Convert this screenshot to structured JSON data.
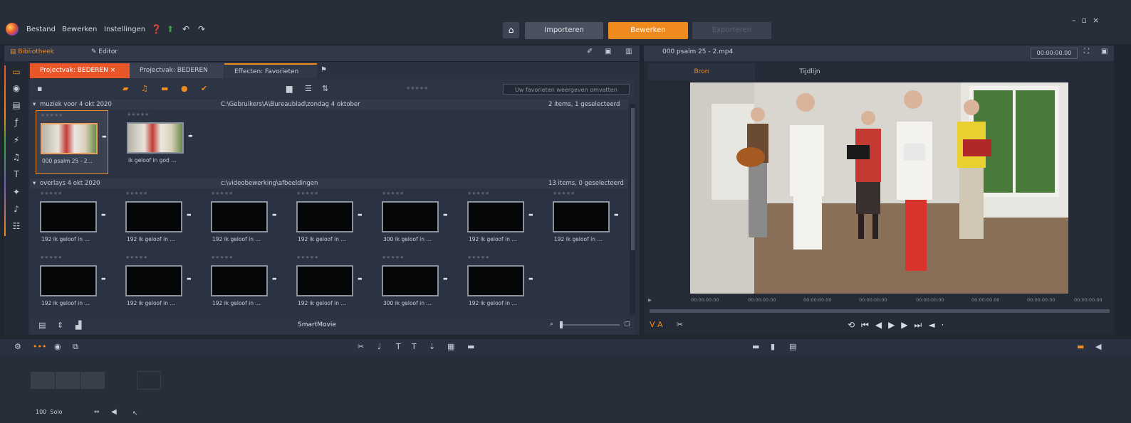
{
  "menu": {
    "file": "Bestand",
    "edit": "Bewerken",
    "settings": "Instellingen"
  },
  "modes": {
    "import": "Importeren",
    "edit": "Bewerken",
    "export": "Exporteren"
  },
  "panel_tabs": {
    "library": "Bibliotheek",
    "editor": "Editor"
  },
  "project_tabs": [
    "Projectvak: BEDEREN",
    "Projectvak: BEDEREN",
    "Effecten: Favorieten"
  ],
  "search_placeholder": "Uw favorieten weergeven omvatten",
  "groups": [
    {
      "title": "muziek voor 4 okt 2020",
      "path": "C:\\Gebruikers\\A\\Bureaublad\\zondag 4 oktober",
      "count": "2 items, 1 geselecteerd",
      "items": [
        {
          "caption": "000 psalm 25 - 2..."
        },
        {
          "caption": "ik geloof in god ..."
        }
      ]
    },
    {
      "title": "overlays 4 okt 2020",
      "path": "c:\\videobewerking\\afbeeldingen",
      "count": "13 items, 0 geselecteerd",
      "items": [
        {
          "caption": "192 ik geloof in ..."
        },
        {
          "caption": "192 ik geloof in ..."
        },
        {
          "caption": "192 ik geloof in ..."
        },
        {
          "caption": "192 ik geloof in ..."
        },
        {
          "caption": "300 ik geloof in ..."
        },
        {
          "caption": "192 ik geloof in ..."
        },
        {
          "caption": "192 ik geloof in ..."
        },
        {
          "caption": "192 ik geloof in ..."
        },
        {
          "caption": "192 ik geloof in ..."
        },
        {
          "caption": "192 ik geloof in ..."
        },
        {
          "caption": "192 ik geloof in ..."
        },
        {
          "caption": "300 ik geloof in ..."
        },
        {
          "caption": "192 ik geloof in ..."
        }
      ]
    }
  ],
  "stars": "★★★★★",
  "smartmovie": "SmartMovie",
  "preview": {
    "filename": "000 psalm 25 - 2.mp4",
    "timecode": "00:00:00.00",
    "tab_source": "Bron",
    "tab_timeline": "Tijdlijn",
    "ruler": [
      "00:00:00.00",
      "00:00:00.00",
      "00:00:00.00",
      "00:00:00.00",
      "00:00:00.00",
      "00:00:00.00",
      "00:00:00.00",
      "00:00:00.00"
    ]
  },
  "timeline": {
    "zoom": "100",
    "zoom_label": "Solo"
  },
  "colors": {
    "accent": "#ee8a1e",
    "active_tab": "#e8562a"
  }
}
